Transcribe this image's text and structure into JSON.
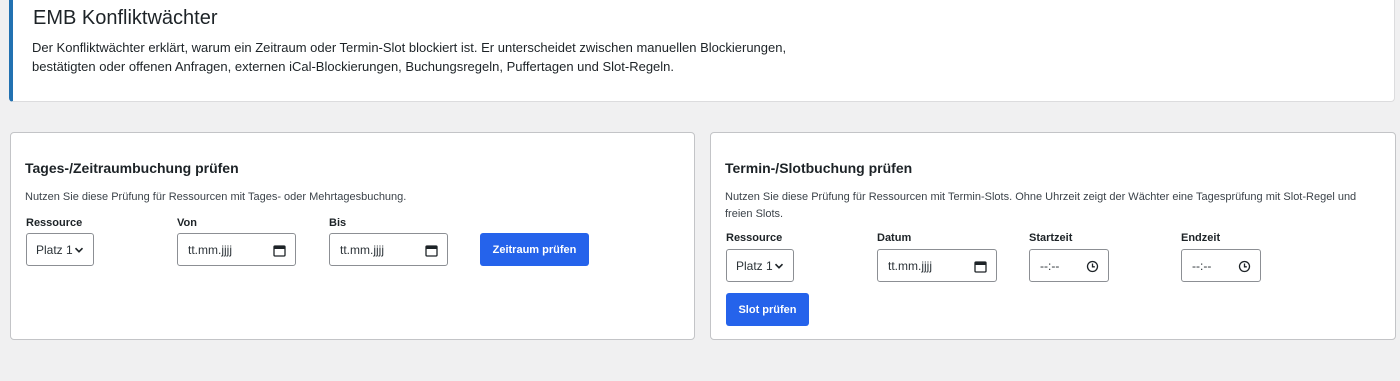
{
  "header": {
    "title": "EMB Konfliktwächter",
    "description": "Der Konfliktwächter erklärt, warum ein Zeitraum oder Termin-Slot blockiert ist. Er unterscheidet zwischen manuellen Blockierungen, bestätigten oder offenen Anfragen, externen iCal-Blockierungen, Buchungsregeln, Puffertagen und Slot-Regeln."
  },
  "range_check": {
    "title": "Tages-/Zeitraumbuchung prüfen",
    "description": "Nutzen Sie diese Prüfung für Ressourcen mit Tages- oder Mehrtagesbuchung.",
    "resource_label": "Ressource",
    "resource_value": "Platz 1",
    "from_label": "Von",
    "from_value": "tt.mm.jjjj",
    "to_label": "Bis",
    "to_value": "tt.mm.jjjj",
    "submit_label": "Zeitraum prüfen"
  },
  "slot_check": {
    "title": "Termin-/Slotbuchung prüfen",
    "description": "Nutzen Sie diese Prüfung für Ressourcen mit Termin-Slots. Ohne Uhrzeit zeigt der Wächter eine Tagesprüfung mit Slot-Regel und freien Slots.",
    "resource_label": "Ressource",
    "resource_value": "Platz 1",
    "date_label": "Datum",
    "date_value": "tt.mm.jjjj",
    "start_label": "Startzeit",
    "start_value": "--:--",
    "end_label": "Endzeit",
    "end_value": "--:--",
    "submit_label": "Slot prüfen"
  },
  "colors": {
    "accent": "#2563eb",
    "notice_border": "#2271b1",
    "background": "#f0f0f1"
  },
  "icons": {
    "select": "chevron-down-icon",
    "date": "calendar-icon",
    "time": "clock-icon"
  }
}
